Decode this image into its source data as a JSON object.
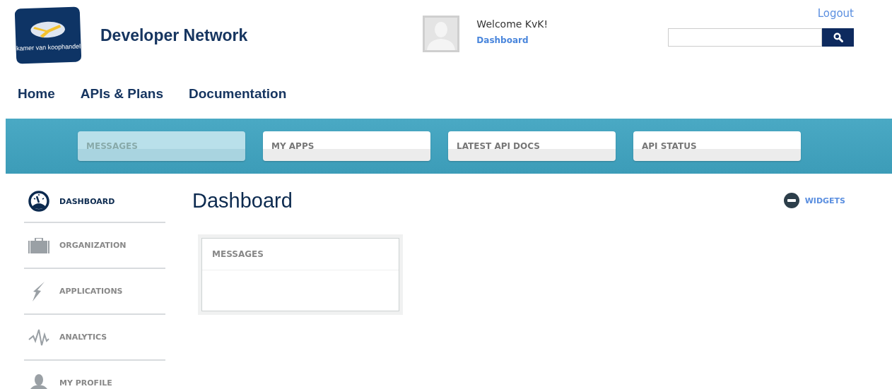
{
  "logo": {
    "text": "kamer van koophandel"
  },
  "site_title": "Developer Network",
  "user": {
    "welcome": "Welcome KvK!",
    "link": "Dashboard"
  },
  "logout": "Logout",
  "nav": [
    "Home",
    "APIs & Plans",
    "Documentation"
  ],
  "tabs": [
    {
      "label": "MESSAGES",
      "selected": true
    },
    {
      "label": "MY APPS",
      "selected": false
    },
    {
      "label": "LATEST API DOCS",
      "selected": false
    },
    {
      "label": "API STATUS",
      "selected": false
    }
  ],
  "sidebar": {
    "items": [
      {
        "label": "DASHBOARD",
        "kind": "gauge",
        "selected": true
      },
      {
        "label": "ORGANIZATION",
        "kind": "briefcase",
        "selected": false
      },
      {
        "label": "APPLICATIONS",
        "kind": "bolt",
        "selected": false
      },
      {
        "label": "ANALYTICS",
        "kind": "pulse",
        "selected": false
      },
      {
        "label": "MY PROFILE",
        "kind": "person",
        "selected": false
      }
    ]
  },
  "page_title": "Dashboard",
  "widgets_toggle": {
    "label": "WIDGETS",
    "expanded": true
  },
  "widgets": [
    {
      "title": "MESSAGES"
    }
  ]
}
